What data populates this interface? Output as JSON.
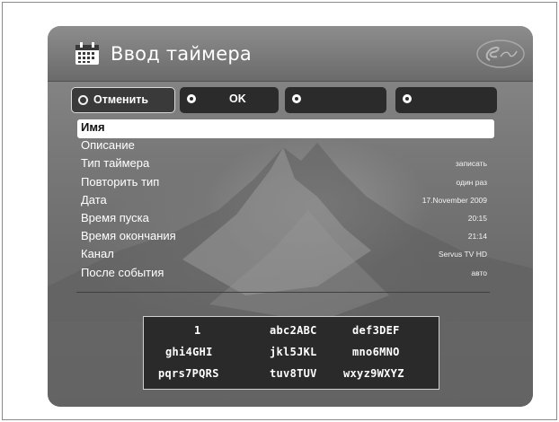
{
  "window": {
    "title": "Ввод таймера"
  },
  "buttons": [
    {
      "label": "Отменить",
      "color": "#ffffff"
    },
    {
      "label": "OK",
      "color": "#ffffff"
    },
    {
      "label": "",
      "color": "#ffffff"
    },
    {
      "label": "",
      "color": "#ffffff"
    }
  ],
  "fields": [
    {
      "label": "Имя",
      "value": "",
      "selected": true
    },
    {
      "label": "Описание",
      "value": ""
    },
    {
      "label": "Тип таймера",
      "value": "записать"
    },
    {
      "label": "Повторить тип",
      "value": "один раз"
    },
    {
      "label": "Дата",
      "value": "17.November 2009"
    },
    {
      "label": "Время пуска",
      "value": "20:15"
    },
    {
      "label": "Время окончания",
      "value": "21:14"
    },
    {
      "label": "Канал",
      "value": "Servus TV HD"
    },
    {
      "label": "После события",
      "value": "авто"
    }
  ],
  "keypad": {
    "keys": [
      [
        "1",
        "abc2ABC",
        "def3DEF"
      ],
      [
        "ghi4GHI",
        "jkl5JKL",
        "mno6MNO"
      ],
      [
        "pqrs7PQRS",
        "tuv8TUV",
        "wxyz9WXYZ"
      ]
    ]
  },
  "icons": {
    "title": "calendar-icon",
    "brand": "servus-logo",
    "button_markers": "circle-icon"
  },
  "colors": {
    "background": "#7a7a7a",
    "panel_dark": "#2b2b2b",
    "text": "#ffffff",
    "selected_field_bg": "#ffffff"
  }
}
